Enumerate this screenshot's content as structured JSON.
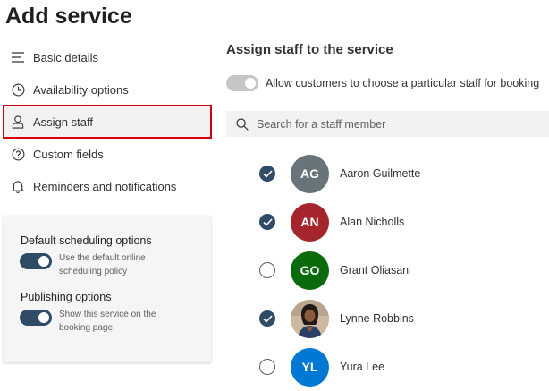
{
  "page": {
    "title": "Add service"
  },
  "nav": {
    "items": [
      {
        "label": "Basic details",
        "icon": "lines-icon"
      },
      {
        "label": "Availability options",
        "icon": "clock-icon"
      },
      {
        "label": "Assign staff",
        "icon": "person-icon",
        "active": true
      },
      {
        "label": "Custom fields",
        "icon": "question-icon"
      },
      {
        "label": "Reminders and notifications",
        "icon": "bell-icon"
      }
    ]
  },
  "options": {
    "default_scheduling": {
      "heading": "Default scheduling options",
      "toggle_on": true,
      "description": "Use the default online scheduling policy"
    },
    "publishing": {
      "heading": "Publishing options",
      "toggle_on": true,
      "description": "Show this service on the booking page"
    }
  },
  "assign": {
    "title": "Assign staff to the service",
    "allow_choice": {
      "label": "Allow customers to choose a particular staff for booking",
      "toggle_on": false
    },
    "search": {
      "placeholder": "Search for a staff member",
      "value": ""
    }
  },
  "staff": [
    {
      "initials": "AG",
      "name": "Aaron Guilmette",
      "checked": true,
      "color": "#68737a"
    },
    {
      "initials": "AN",
      "name": "Alan Nicholls",
      "checked": true,
      "color": "#a4262c"
    },
    {
      "initials": "GO",
      "name": "Grant Oliasani",
      "checked": false,
      "color": "#0b6a0b"
    },
    {
      "initials": "",
      "name": "Lynne Robbins",
      "checked": true,
      "color": "#c7b39b",
      "photo": true
    },
    {
      "initials": "YL",
      "name": "Yura Lee",
      "checked": false,
      "color": "#0078d4"
    }
  ],
  "colors": {
    "accent": "#2f4b66",
    "highlight": "#d6000f"
  }
}
